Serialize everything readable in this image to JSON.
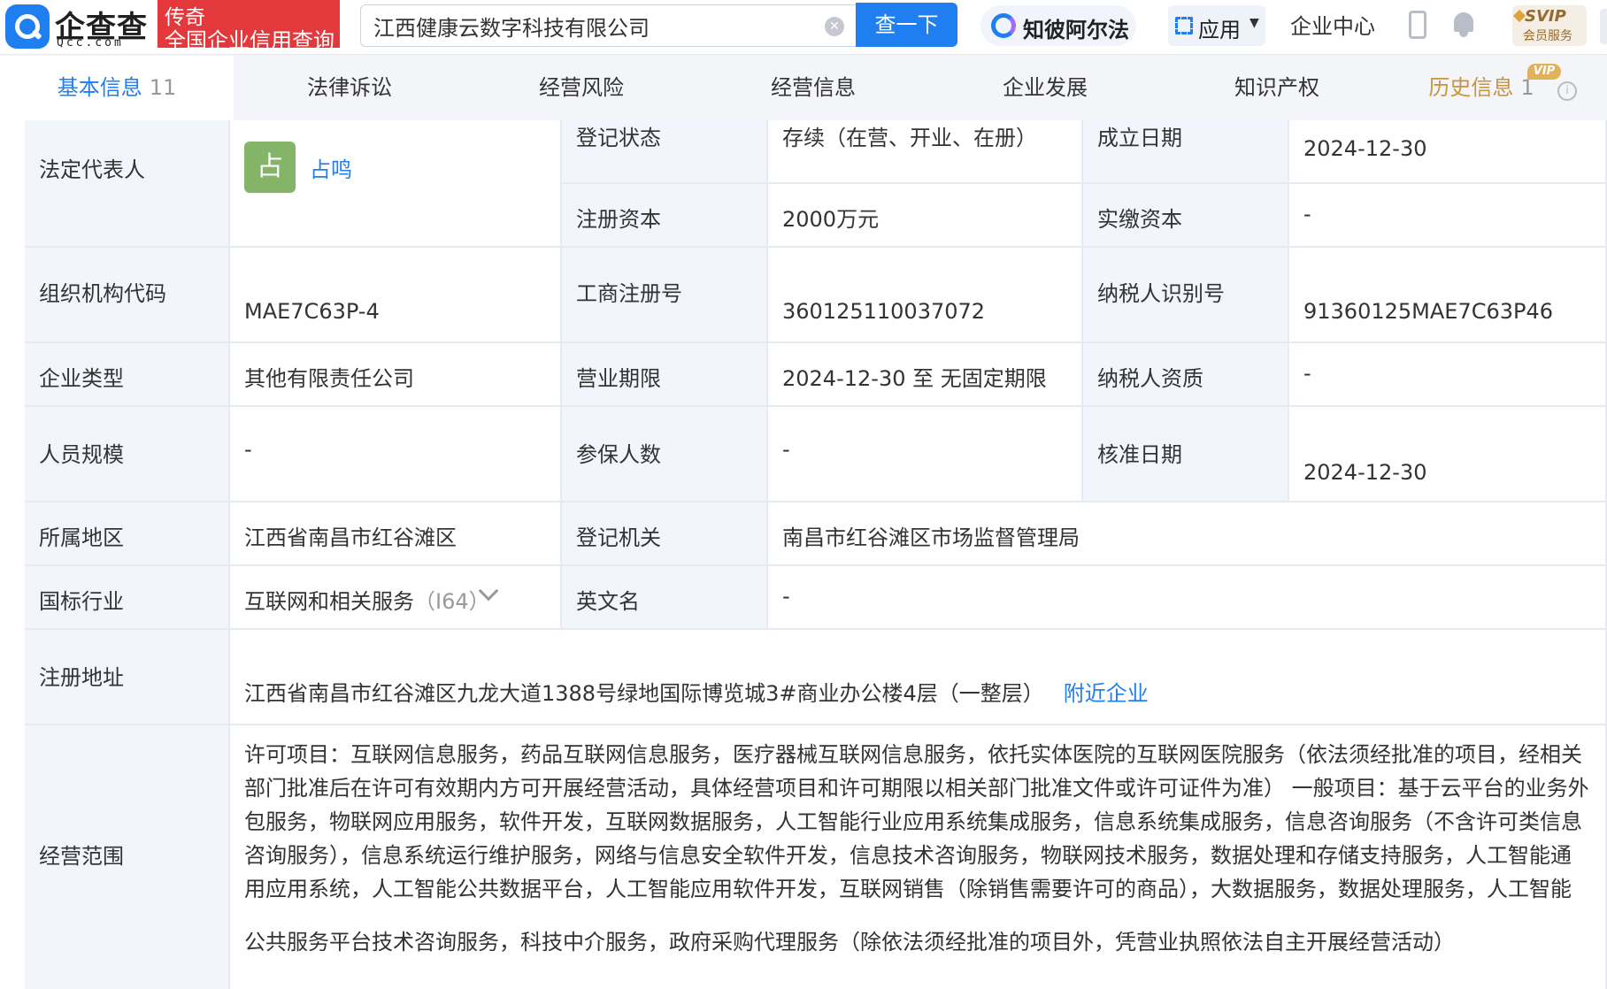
{
  "header": {
    "logo_text": "企查查",
    "logo_sub": "Qcc.com",
    "badge_line1": "传奇",
    "badge_line2": "全国企业信用查询",
    "search_value": "江西健康云数字科技有限公司",
    "search_button": "查一下",
    "ai_label": "知彼阿尔法",
    "app_label": "应用",
    "enterprise_center": "企业中心",
    "svip_title": "SVIP",
    "svip_sub": "会员服务"
  },
  "tabs": [
    {
      "label": "基本信息",
      "count": "11"
    },
    {
      "label": "法律诉讼"
    },
    {
      "label": "经营风险"
    },
    {
      "label": "经营信息"
    },
    {
      "label": "企业发展"
    },
    {
      "label": "知识产权"
    },
    {
      "label": "历史信息",
      "count": "1",
      "tag": "VIP"
    }
  ],
  "info": {
    "legal_rep_label": "法定代表人",
    "legal_rep_avatar": "占",
    "legal_rep_name": "占鸣",
    "reg_status_label": "登记状态",
    "reg_status": "存续（在营、开业、在册）",
    "found_date_label": "成立日期",
    "found_date": "2024-12-30",
    "reg_capital_label": "注册资本",
    "reg_capital": "2000万元",
    "paid_capital_label": "实缴资本",
    "paid_capital": "-",
    "org_code_label": "组织机构代码",
    "org_code": "MAE7C63P-4",
    "biz_reg_no_label": "工商注册号",
    "biz_reg_no": "360125110037072",
    "tax_id_label": "纳税人识别号",
    "tax_id": "91360125MAE7C63P46",
    "company_type_label": "企业类型",
    "company_type": "其他有限责任公司",
    "biz_term_label": "营业期限",
    "biz_term": "2024-12-30 至 无固定期限",
    "tax_qual_label": "纳税人资质",
    "tax_qual": "-",
    "staff_size_label": "人员规模",
    "staff_size": "-",
    "insured_label": "参保人数",
    "insured": "-",
    "approve_date_label": "核准日期",
    "approve_date": "2024-12-30",
    "region_label": "所属地区",
    "region": "江西省南昌市红谷滩区",
    "reg_authority_label": "登记机关",
    "reg_authority": "南昌市红谷滩区市场监督管理局",
    "industry_label": "国标行业",
    "industry": "互联网和相关服务",
    "industry_code": "（I64）",
    "english_name_label": "英文名",
    "english_name": "-",
    "address_label": "注册地址",
    "address": "江西省南昌市红谷滩区九龙大道1388号绿地国际博览城3#商业办公楼4层（一整层）",
    "nearby_link": "附近企业",
    "scope_label": "经营范围",
    "scope_lines": [
      "许可项目：互联网信息服务，药品互联网信息服务，医疗器械互联网信息服务，依托实体医院的互联网医院服务（依法须经批准的项目，经相关",
      "部门批准后在许可有效期内方可开展经营活动，具体经营项目和许可期限以相关部门批准文件或许可证件为准） 一般项目：基于云平台的业务外",
      "包服务，物联网应用服务，软件开发，互联网数据服务，人工智能行业应用系统集成服务，信息系统集成服务，信息咨询服务（不含许可类信息",
      "咨询服务），信息系统运行维护服务，网络与信息安全软件开发，信息技术咨询服务，物联网技术服务，数据处理和存储支持服务，人工智能通",
      "用应用系统，人工智能公共数据平台，人工智能应用软件开发，互联网销售（除销售需要许可的商品），大数据服务，数据处理服务，人工智能",
      "公共服务平台技术咨询服务，科技中介服务，政府采购代理服务（除依法须经批准的项目外，凭营业执照依法自主开展经营活动）"
    ]
  }
}
